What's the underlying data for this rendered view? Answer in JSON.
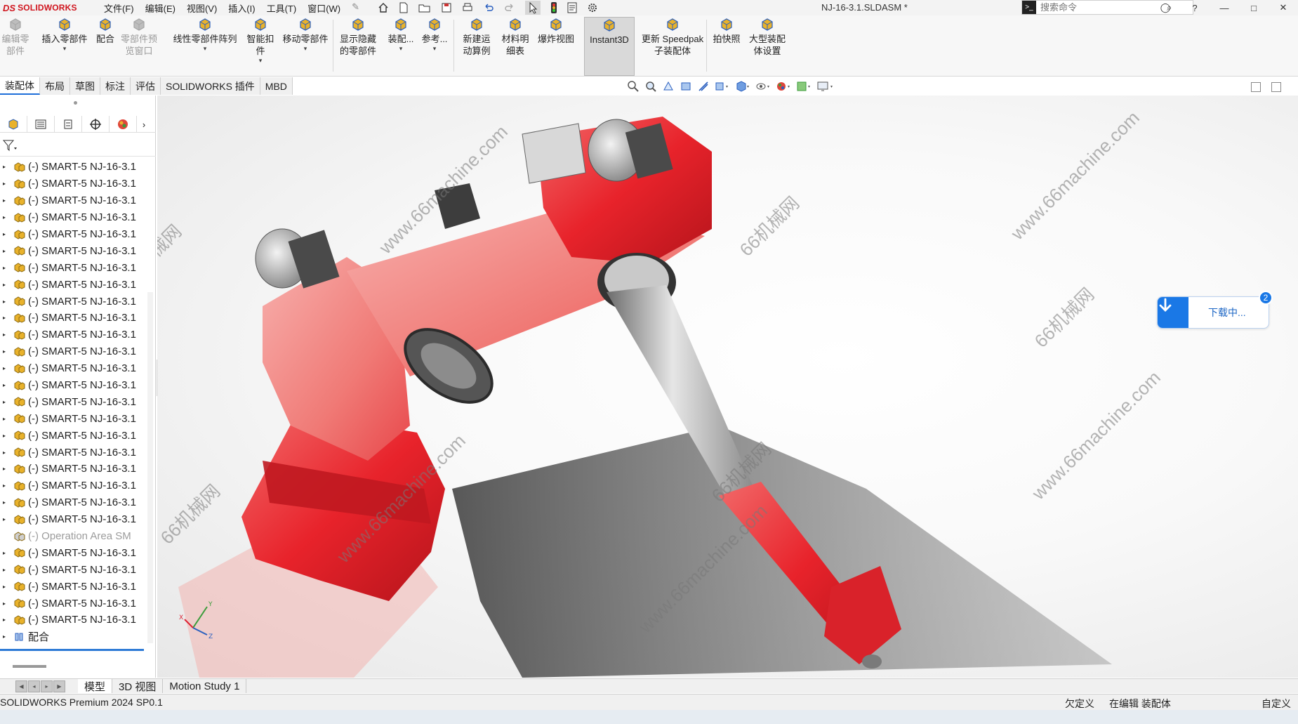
{
  "app": {
    "logo_ds": "DS",
    "logo_text": "SOLIDWORKS",
    "document_title": "NJ-16-3.1.SLDASM *",
    "search_placeholder": "搜索命令",
    "product": "SOLIDWORKS Premium 2024 SP0.1"
  },
  "menu": [
    "文件(F)",
    "编辑(E)",
    "视图(V)",
    "插入(I)",
    "工具(T)",
    "窗口(W)"
  ],
  "ribbon": [
    {
      "l1": "编辑零",
      "l2": "部件",
      "dim": true
    },
    {
      "l1": "插入零部件",
      "l2": "",
      "dim": false
    },
    {
      "l1": "配合",
      "l2": "",
      "dim": false
    },
    {
      "l1": "零部件预",
      "l2": "览窗口",
      "dim": true
    },
    {
      "l1": "线性零部件阵列",
      "l2": "",
      "dim": false
    },
    {
      "l1": "智能扣",
      "l2": "件",
      "dim": false
    },
    {
      "l1": "移动零部件",
      "l2": "",
      "dim": false
    },
    {
      "l1": "显示隐藏",
      "l2": "的零部件",
      "dim": false
    },
    {
      "l1": "装配...",
      "l2": "",
      "dim": false
    },
    {
      "l1": "参考...",
      "l2": "",
      "dim": false
    },
    {
      "l1": "新建运",
      "l2": "动算例",
      "dim": false
    },
    {
      "l1": "材料明",
      "l2": "细表",
      "dim": false
    },
    {
      "l1": "爆炸视图",
      "l2": "",
      "dim": false
    },
    {
      "l1": "Instant3D",
      "l2": "",
      "dim": false
    },
    {
      "l1": "更新 Speedpak",
      "l2": "子装配体",
      "dim": false
    },
    {
      "l1": "拍快照",
      "l2": "",
      "dim": false
    },
    {
      "l1": "大型装配",
      "l2": "体设置",
      "dim": false
    }
  ],
  "tabs": [
    "装配体",
    "布局",
    "草图",
    "标注",
    "评估",
    "SOLIDWORKS 插件",
    "MBD"
  ],
  "tree": {
    "items": [
      "(-) SMART-5 NJ-16-3.1",
      "(-) SMART-5 NJ-16-3.1",
      "(-) SMART-5 NJ-16-3.1",
      "(-) SMART-5 NJ-16-3.1",
      "(-) SMART-5 NJ-16-3.1",
      "(-) SMART-5 NJ-16-3.1",
      "(-) SMART-5 NJ-16-3.1",
      "(-) SMART-5 NJ-16-3.1",
      "(-) SMART-5 NJ-16-3.1",
      "(-) SMART-5 NJ-16-3.1",
      "(-) SMART-5 NJ-16-3.1",
      "(-) SMART-5 NJ-16-3.1",
      "(-) SMART-5 NJ-16-3.1",
      "(-) SMART-5 NJ-16-3.1",
      "(-) SMART-5 NJ-16-3.1",
      "(-) SMART-5 NJ-16-3.1",
      "(-) SMART-5 NJ-16-3.1",
      "(-) SMART-5 NJ-16-3.1",
      "(-) SMART-5 NJ-16-3.1",
      "(-) SMART-5 NJ-16-3.1",
      "(-) SMART-5 NJ-16-3.1",
      "(-) SMART-5 NJ-16-3.1",
      "(-) Operation Area SM",
      "(-) SMART-5 NJ-16-3.1",
      "(-) SMART-5 NJ-16-3.1",
      "(-) SMART-5 NJ-16-3.1",
      "(-) SMART-5 NJ-16-3.1",
      "(-) SMART-5 NJ-16-3.1"
    ],
    "mates": "配合"
  },
  "toast": {
    "text": "下载中...",
    "badge": "2"
  },
  "watermarks": [
    "66机械网",
    "www.66machine.com"
  ],
  "bottom_tabs": [
    "模型",
    "3D 视图",
    "Motion Study 1"
  ],
  "status": {
    "s1": "欠定义",
    "s2": "在编辑 装配体",
    "s3": "自定义"
  },
  "triad": {
    "x": "X",
    "y": "Y",
    "z": "Z"
  },
  "colors": {
    "robot_red": "#e8232b",
    "accent_blue": "#1a78e6",
    "active_tab_underline": "#1e6fd9"
  }
}
